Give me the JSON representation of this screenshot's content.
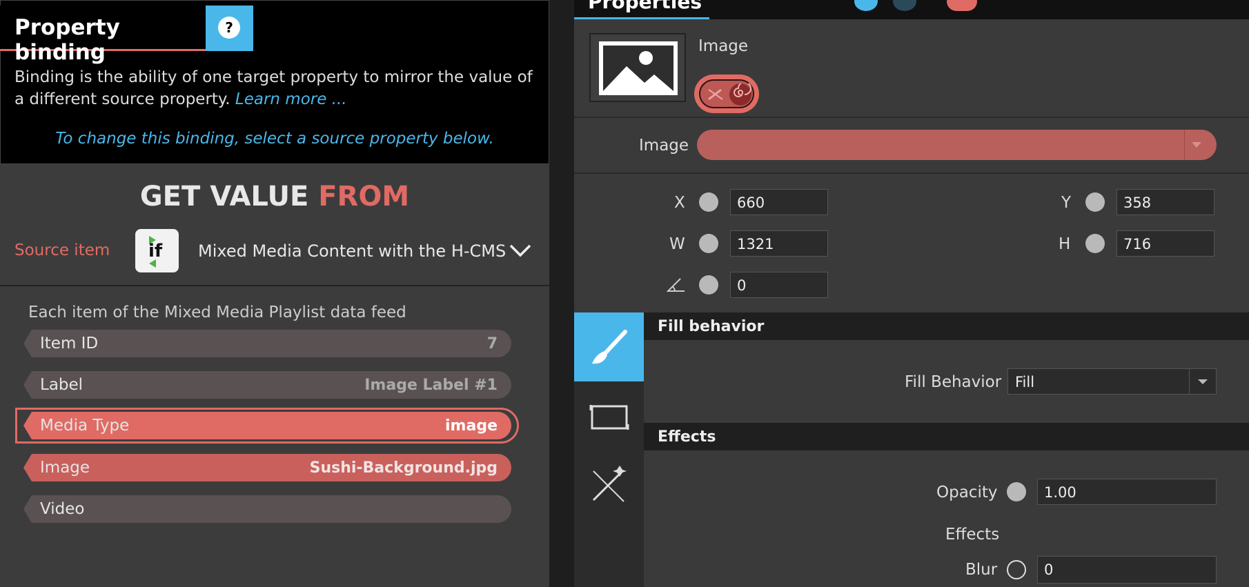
{
  "left_panel": {
    "title": "Property binding",
    "help": "?",
    "description": "Binding is the ability of one target property to mirror the value of a different source property.",
    "learn_more": "Learn more ...",
    "hint": "To change this binding, select a source property below.",
    "get_value": "GET VALUE",
    "from": "FROM",
    "source_label": "Source item",
    "source_name": "Mixed Media Content with the H-CMS",
    "feed_title": "Each item of the Mixed Media Playlist data feed",
    "rows": [
      {
        "label": "Item ID",
        "value": "7"
      },
      {
        "label": "Label",
        "value": "Image Label #1"
      },
      {
        "label": "Media Type",
        "value": "image"
      },
      {
        "label": "Image",
        "value": "Sushi-Background.jpg"
      },
      {
        "label": "Video",
        "value": ""
      }
    ]
  },
  "right_panel": {
    "tab": "Properties",
    "item_name": "Image",
    "image_field_label": "Image",
    "x_label": "X",
    "x": "660",
    "y_label": "Y",
    "y": "358",
    "w_label": "W",
    "w": "1321",
    "h_label": "H",
    "h": "716",
    "angle": "0",
    "fill_section": "Fill behavior",
    "fill_label": "Fill Behavior",
    "fill_value": "Fill",
    "effects_section": "Effects",
    "opacity_label": "Opacity",
    "opacity": "1.00",
    "effects_label": "Effects",
    "blur_label": "Blur",
    "blur": "0"
  },
  "colors": {
    "accent": "#4ab7ea",
    "binding": "#e06b64"
  }
}
